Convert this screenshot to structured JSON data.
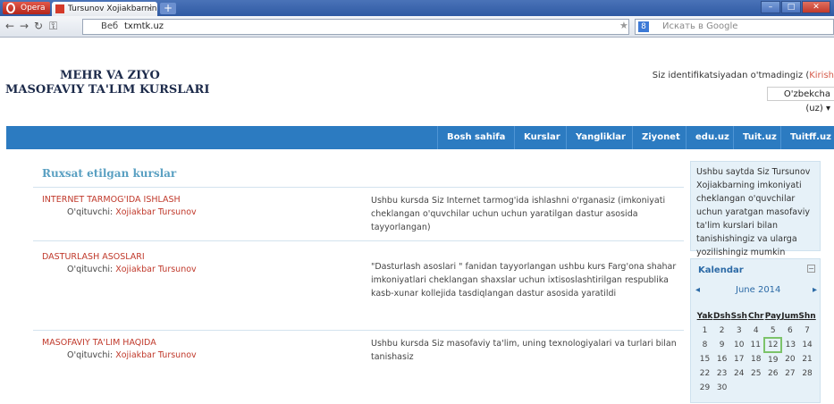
{
  "browser": {
    "opera_label": "Opera",
    "tab_title": "Tursunov Xojiakbarnin...",
    "tab_close": "×",
    "new_tab": "+",
    "addr_label": "Веб",
    "url": "txmtk.uz",
    "search_placeholder": "Искать в Google",
    "search_engine": "8"
  },
  "site": {
    "logo_line1": "MEHR VA ZIYO",
    "logo_line2": "MASOFAVIY TA'LIM KURSLARI",
    "login_text": "Siz identifikatsiyadan o'tmadingiz (",
    "login_link": "Kirish",
    "language": "O'zbekcha (uz) ▾"
  },
  "menu": [
    "Bosh sahifa",
    "Kurslar",
    "Yangliklar",
    "Ziyonet",
    "edu.uz",
    "Tuit.uz",
    "Tuitff.uz"
  ],
  "courses": {
    "heading": "Ruxsat etilgan kurslar",
    "items": [
      {
        "title": "INTERNET TARMOG'IDA ISHLASH",
        "teacher_label": "O'qituvchi: ",
        "teacher": "Xojiakbar Tursunov",
        "description": "Ushbu kursda Siz Internet tarmog'ida ishlashni o'rganasiz (imkoniyati cheklangan o'quvchilar uchun uchun yaratilgan dastur asosida tayyorlangan)"
      },
      {
        "title": "DASTURLASH ASOSLARI",
        "teacher_label": "O'qituvchi: ",
        "teacher": "Xojiakbar Tursunov",
        "description": "\"Dasturlash asoslari \" fanidan tayyorlangan ushbu kurs Farg'ona shahar imkoniyatlari cheklangan shaxslar uchun ixtisoslashtirilgan respublika kasb-xunar kollejida tasdiqlangan dastur asosida yaratildi"
      },
      {
        "title": "MASOFAVIY TA'LIM HAQIDA",
        "teacher_label": "O'qituvchi: ",
        "teacher": "Xojiakbar Tursunov",
        "description": "Ushbu kursda Siz masofaviy ta'lim, uning texnologiyalari va turlari bilan tanishasiz"
      }
    ]
  },
  "sidebar": {
    "info": "Ushbu saytda Siz Tursunov Xojiakbarning imkoniyati cheklangan o'quvchilar uchun yaratgan masofaviy ta'lim kurslari bilan tanishishingiz va ularga yozilishingiz mumkin",
    "calendar_title": "Kalendar",
    "month": "June 2014",
    "prev": "◂",
    "next": "▸",
    "days": [
      "Yak",
      "Dsh",
      "Ssh",
      "Chr",
      "Pay",
      "Jum",
      "Shn"
    ],
    "weeks": [
      [
        "1",
        "2",
        "3",
        "4",
        "5",
        "6",
        "7"
      ],
      [
        "8",
        "9",
        "10",
        "11",
        "12",
        "13",
        "14"
      ],
      [
        "15",
        "16",
        "17",
        "18",
        "19",
        "20",
        "21"
      ],
      [
        "22",
        "23",
        "24",
        "25",
        "26",
        "27",
        "28"
      ],
      [
        "29",
        "30",
        "",
        "",
        "",
        "",
        ""
      ]
    ],
    "today": "12"
  }
}
